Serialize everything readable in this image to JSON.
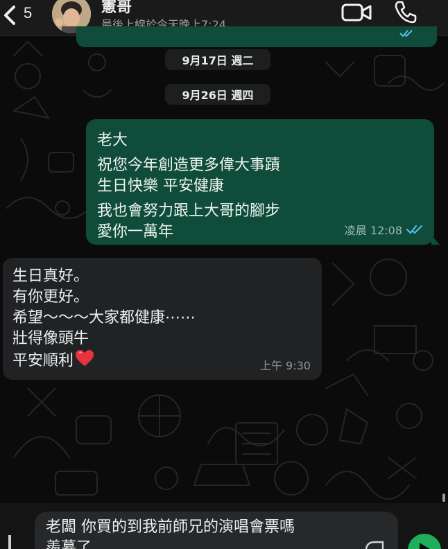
{
  "header": {
    "unread_count": "5",
    "contact_name": "憲哥",
    "last_seen": "最後上線於今天晚上7:24",
    "icons": [
      "chevron-left-icon",
      "video-call-icon",
      "phone-icon"
    ]
  },
  "dates": {
    "first": "9月17日 週二",
    "second": "9月26日 週四"
  },
  "outgoing": {
    "lines": [
      "老大",
      "祝您今年創造更多偉大事蹟",
      "生日快樂 平安健康",
      "我也會努力跟上大哥的腳步",
      "愛你一萬年"
    ],
    "time": "凌晨 12:08",
    "status_icon": "double-check-icon"
  },
  "incoming": {
    "lines": [
      "生日真好。",
      "有你更好。",
      "希望～～～大家都健康⋯⋯",
      "壯得像頭牛",
      "平安順利"
    ],
    "emoji": "heart-icon",
    "time": "上午 9:30"
  },
  "composer": {
    "text_line1": "老闆 你買的到我前師兄的演唱會票嗎",
    "text_line2": "羨慕了"
  },
  "colors": {
    "outgoing_bubble": "#0f4c3a",
    "incoming_bubble": "#202224",
    "read_ticks": "#53bdeb",
    "send_button": "#1fae5b"
  }
}
